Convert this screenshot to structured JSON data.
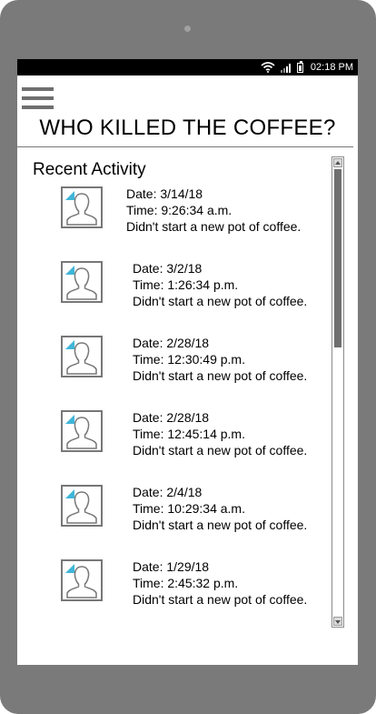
{
  "status_bar": {
    "time": "02:18 PM",
    "icons": [
      "wifi-icon",
      "signal-icon",
      "battery-icon"
    ]
  },
  "header": {
    "menu_icon": "hamburger-menu-icon",
    "title": "WHO KILLED THE COFFEE?"
  },
  "section": {
    "title": "Recent Activity"
  },
  "activities": [
    {
      "date": "Date: 3/14/18",
      "time": "Time: 9:26:34 a.m.",
      "message": "Didn't start a new pot of coffee."
    },
    {
      "date": "Date: 3/2/18",
      "time": "Time: 1:26:34 p.m.",
      "message": "Didn't start a new pot of coffee."
    },
    {
      "date": "Date: 2/28/18",
      "time": "Time: 12:30:49 p.m.",
      "message": "Didn't start a new pot of coffee."
    },
    {
      "date": "Date: 2/28/18",
      "time": "Time: 12:45:14 p.m.",
      "message": "Didn't start a new pot of coffee."
    },
    {
      "date": "Date: 2/4/18",
      "time": "Time: 10:29:34 a.m.",
      "message": "Didn't start a new pot of coffee."
    },
    {
      "date": "Date: 1/29/18",
      "time": "Time: 2:45:32 p.m.",
      "message": "Didn't start a new pot of coffee."
    }
  ],
  "colors": {
    "device_frame": "#7a7a7a",
    "status_bar": "#000000",
    "avatar_badge": "#3fb6d8",
    "scroll_thumb": "#6f6f6f"
  }
}
